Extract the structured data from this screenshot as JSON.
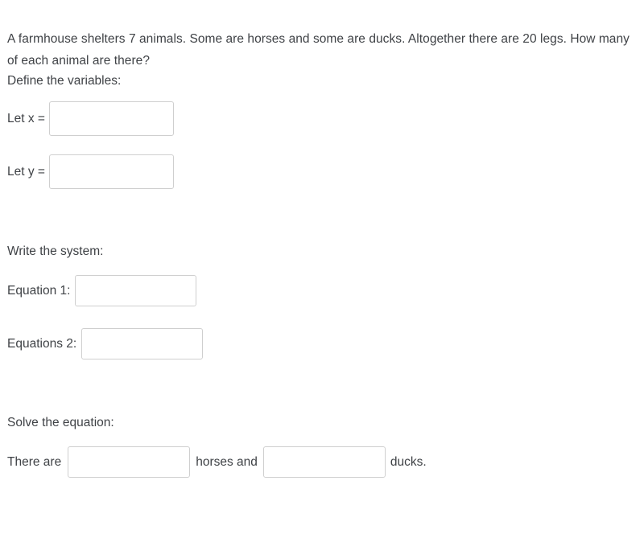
{
  "problem": {
    "text": "A farmhouse shelters 7 animals. Some are horses and some are ducks. Altogether there are 20 legs. How many of each animal are there?"
  },
  "sections": {
    "define": {
      "heading": "Define the variables:",
      "fields": [
        {
          "label": "Let x =",
          "value": "",
          "placeholder": ""
        },
        {
          "label": "Let y =",
          "value": "",
          "placeholder": ""
        }
      ]
    },
    "system": {
      "heading": "Write the system:",
      "fields": [
        {
          "label": "Equation 1:",
          "value": "",
          "placeholder": ""
        },
        {
          "label": "Equations 2:",
          "value": "",
          "placeholder": ""
        }
      ]
    },
    "solve": {
      "heading": "Solve the equation:",
      "sentence": {
        "lead": "There are",
        "middle": "horses and",
        "tail": "ducks.",
        "horses_value": "",
        "ducks_value": ""
      }
    }
  },
  "colors": {
    "text": "#3f4246",
    "input_border": "#cfcfcf",
    "background": "#ffffff"
  }
}
